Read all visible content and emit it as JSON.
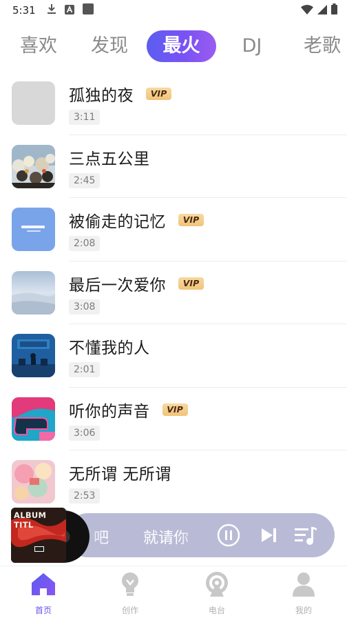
{
  "status_bar": {
    "time": "5:31",
    "icons": [
      "download-icon",
      "font-a-icon",
      "square-icon",
      "wifi-icon",
      "signal-icon",
      "battery-icon"
    ]
  },
  "tabs": [
    {
      "label": "喜欢",
      "active": false
    },
    {
      "label": "发现",
      "active": false
    },
    {
      "label": "最火",
      "active": true
    },
    {
      "label": "DJ",
      "active": false
    },
    {
      "label": "老歌",
      "active": false
    }
  ],
  "songs": [
    {
      "title": "孤独的夜",
      "vip": true,
      "duration": "3:11",
      "cover": "placeholder"
    },
    {
      "title": "三点五公里",
      "vip": false,
      "duration": "2:45",
      "cover": "flowers"
    },
    {
      "title": "被偷走的记忆",
      "vip": true,
      "duration": "2:08",
      "cover": "blue-text"
    },
    {
      "title": "最后一次爱你",
      "vip": true,
      "duration": "3:08",
      "cover": "sky"
    },
    {
      "title": "不懂我的人",
      "vip": false,
      "duration": "2:01",
      "cover": "room"
    },
    {
      "title": "听你的声音",
      "vip": true,
      "duration": "3:06",
      "cover": "neon"
    },
    {
      "title": "无所谓 无所谓",
      "vip": false,
      "duration": "2:53",
      "cover": "pastel"
    }
  ],
  "vip_label": "VIP",
  "player": {
    "album_title": "ALBUM TITL",
    "lyric_left": "吧",
    "lyric_right": "就请你"
  },
  "bottom_nav": [
    {
      "label": "首页",
      "icon": "home-icon",
      "active": true
    },
    {
      "label": "创作",
      "icon": "lightbulb-icon",
      "active": false
    },
    {
      "label": "电台",
      "icon": "radio-icon",
      "active": false
    },
    {
      "label": "我的",
      "icon": "profile-icon",
      "active": false
    }
  ],
  "colors": {
    "accent": "#6a55ee",
    "vip_badge": "#f1c37b",
    "player_bar": "#b9bbd6"
  }
}
